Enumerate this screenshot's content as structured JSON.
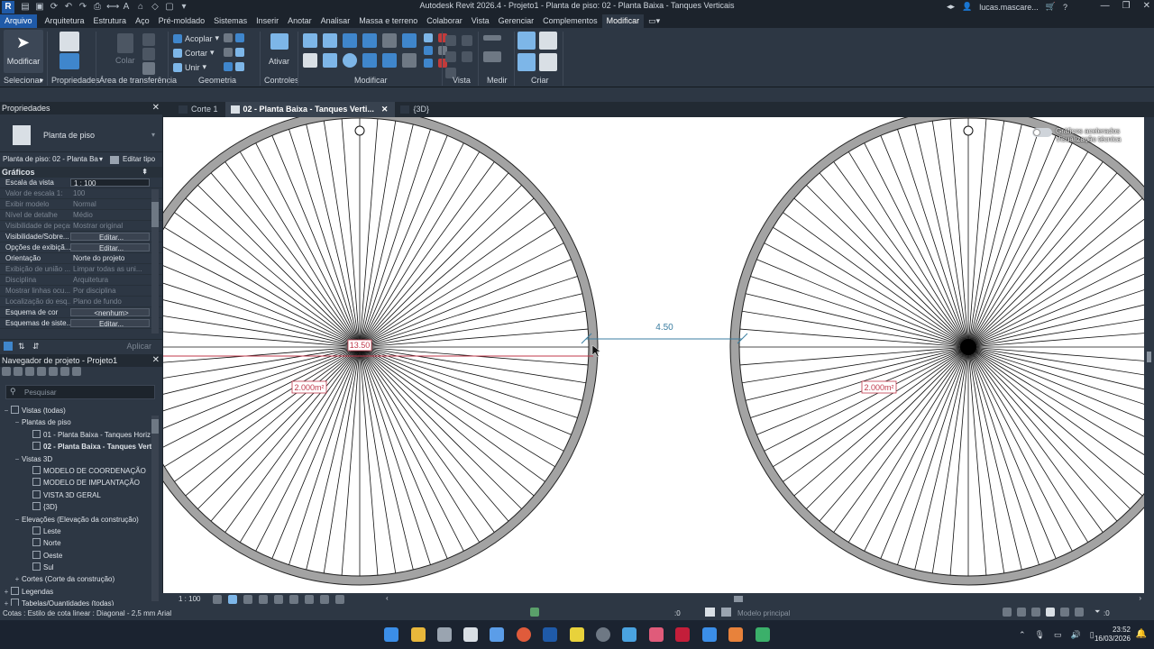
{
  "window": {
    "title": "Autodesk Revit 2026.4 - Projeto1 - Planta de piso: 02 - Planta Baixa - Tanques Verticais",
    "user": "lucas.mascare...",
    "logo_letter": "R"
  },
  "menu": {
    "items": [
      "Arquivo",
      "Arquitetura",
      "Estrutura",
      "Aço",
      "Pré-moldado",
      "Sistemas",
      "Inserir",
      "Anotar",
      "Analisar",
      "Massa e terreno",
      "Colaborar",
      "Vista",
      "Gerenciar",
      "Complementos",
      "Modificar"
    ],
    "active": "Modificar"
  },
  "ribbon": {
    "modify_label": "Modificar",
    "colar_label": "Colar",
    "acoplar_label": "Acoplar",
    "cortar_label": "Cortar",
    "unir_label": "Unir",
    "ativar_label": "Ativar",
    "groups": [
      "Selecionar",
      "Propriedades",
      "Área de transferência",
      "Geometria",
      "Controles",
      "Modificar",
      "Vista",
      "Medir",
      "Criar"
    ]
  },
  "properties": {
    "panel_title": "Propriedades",
    "type_name": "Planta de piso",
    "selector": "Planta de piso: 02 - Planta Ba",
    "edit_type": "Editar tipo",
    "section": "Gráficos",
    "rows": [
      {
        "k": "Escala da vista",
        "v": "1 : 100",
        "kind": "field"
      },
      {
        "k": "Valor de escala    1:",
        "v": "100",
        "kind": "dim"
      },
      {
        "k": "Exibir modelo",
        "v": "Normal",
        "kind": "dim"
      },
      {
        "k": "Nível de detalhe",
        "v": "Médio",
        "kind": "dim"
      },
      {
        "k": "Visibilidade de peças",
        "v": "Mostrar original",
        "kind": "dim"
      },
      {
        "k": "Visibilidade/Sobre...",
        "v": "Editar...",
        "kind": "btn"
      },
      {
        "k": "Opções de exibiçã...",
        "v": "Editar...",
        "kind": "btn"
      },
      {
        "k": "Orientação",
        "v": "Norte do projeto",
        "kind": "text"
      },
      {
        "k": "Exibição de união ...",
        "v": "Limpar todas as uni...",
        "kind": "dim"
      },
      {
        "k": "Disciplina",
        "v": "Arquitetura",
        "kind": "dim"
      },
      {
        "k": "Mostrar linhas ocu...",
        "v": "Por disciplina",
        "kind": "dim"
      },
      {
        "k": "Localização do esq...",
        "v": "Plano de fundo",
        "kind": "dim"
      },
      {
        "k": "Esquema de cor",
        "v": "<nenhum>",
        "kind": "btn"
      },
      {
        "k": "Esquemas de siste...",
        "v": "Editar...",
        "kind": "btn"
      }
    ],
    "apply": "Aplicar"
  },
  "browser": {
    "panel_title": "Navegador de projeto - Projeto1",
    "search_placeholder": "Pesquisar",
    "rows": [
      {
        "label": "Vistas (todas)",
        "level": 0,
        "tog": "−",
        "icon": true
      },
      {
        "label": "Plantas de piso",
        "level": 1,
        "tog": "−",
        "icon": false
      },
      {
        "label": "01 - Planta Baixa - Tanques Horiz",
        "level": 2,
        "tog": "",
        "icon": true
      },
      {
        "label": "02 - Planta Baixa - Tanques Verti",
        "level": 2,
        "tog": "",
        "icon": true,
        "bold": true
      },
      {
        "label": "Vistas 3D",
        "level": 1,
        "tog": "−",
        "icon": false
      },
      {
        "label": "MODELO DE COORDENAÇÃO",
        "level": 2,
        "tog": "",
        "icon": true
      },
      {
        "label": "MODELO DE IMPLANTAÇÃO",
        "level": 2,
        "tog": "",
        "icon": true
      },
      {
        "label": "VISTA 3D GERAL",
        "level": 2,
        "tog": "",
        "icon": true
      },
      {
        "label": "{3D}",
        "level": 2,
        "tog": "",
        "icon": true
      },
      {
        "label": "Elevações (Elevação da construção)",
        "level": 1,
        "tog": "−",
        "icon": false
      },
      {
        "label": "Leste",
        "level": 2,
        "tog": "",
        "icon": true
      },
      {
        "label": "Norte",
        "level": 2,
        "tog": "",
        "icon": true
      },
      {
        "label": "Oeste",
        "level": 2,
        "tog": "",
        "icon": true
      },
      {
        "label": "Sul",
        "level": 2,
        "tog": "",
        "icon": true
      },
      {
        "label": "Cortes (Corte da construção)",
        "level": 1,
        "tog": "+",
        "icon": false
      },
      {
        "label": "Legendas",
        "level": 0,
        "tog": "+",
        "icon": true
      },
      {
        "label": "Tabelas/Quantidades (todas)",
        "level": 0,
        "tog": "+",
        "icon": true
      }
    ]
  },
  "tabs": [
    {
      "label": "Corte 1",
      "active": false,
      "close": false
    },
    {
      "label": "02 - Planta Baixa - Tanques Verti...",
      "active": true,
      "close": true
    },
    {
      "label": "{3D}",
      "active": false,
      "close": false
    }
  ],
  "canvas": {
    "dimension_label": "4.50",
    "rotation_label": "13.50",
    "area_left": "2.000m²",
    "area_right": "2.000m²",
    "overlay_line1": "Gráficos acelerados",
    "overlay_line2": "Visualização técnica",
    "spoke_count": 80,
    "dim_color": "#3b7ea1",
    "temp_line_color": "#c0394b"
  },
  "viewbar": {
    "scale": "1 : 100"
  },
  "status": {
    "hint": "Cotas : Estilo de cota linear : Diagonal - 2,5 mm Arial",
    "model": "Modelo principal",
    "counter": ":0",
    "filter_count": ":0"
  },
  "taskbar": {
    "time": "23:52",
    "date": "16/03/2026"
  }
}
